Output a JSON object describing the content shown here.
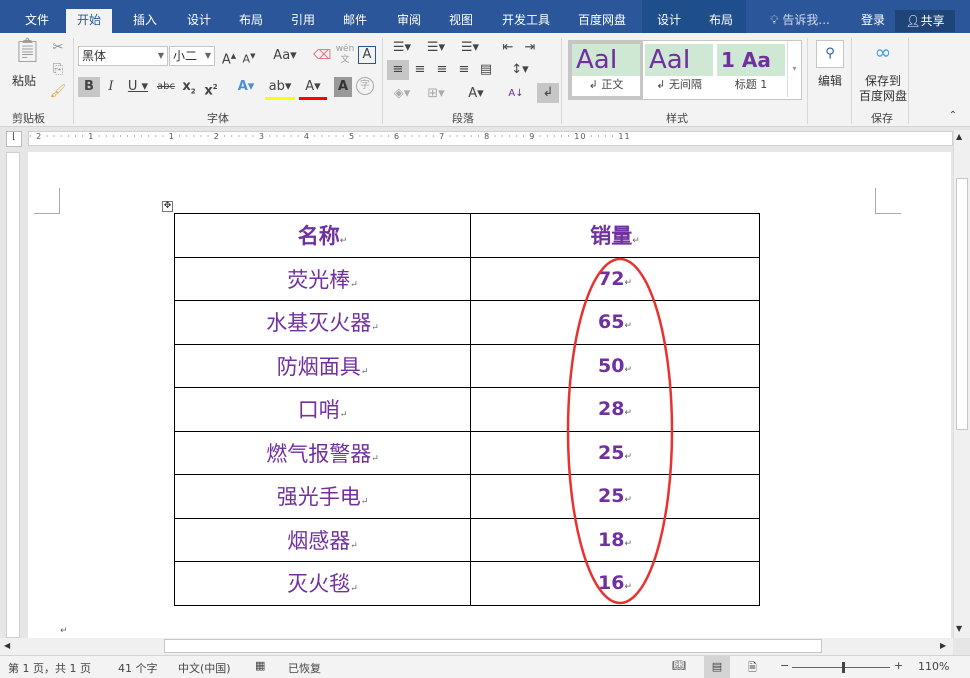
{
  "tabs": [
    "文件",
    "开始",
    "插入",
    "设计",
    "布局",
    "引用",
    "邮件",
    "审阅",
    "视图",
    "开发工具",
    "百度网盘",
    "设计",
    "布局"
  ],
  "active_tab": "开始",
  "tell_me": "告诉我...",
  "login": "登录",
  "share": "共享",
  "ribbon": {
    "clipboard": {
      "paste": "粘贴",
      "label": "剪贴板"
    },
    "font": {
      "family": "黑体",
      "size": "小二",
      "label": "字体"
    },
    "paragraph": {
      "label": "段落"
    },
    "styles": {
      "items": [
        {
          "preview": "AaI",
          "name": "正文"
        },
        {
          "preview": "AaI",
          "name": "无间隔"
        },
        {
          "preview": "1 Aa",
          "name": "标题 1"
        }
      ],
      "label": "样式"
    },
    "edit": {
      "label": "编辑"
    },
    "save": {
      "button": "保存到\n百度网盘",
      "label": "保存"
    }
  },
  "table": {
    "headers": [
      "名称",
      "销量"
    ],
    "rows": [
      [
        "荧光棒",
        "72"
      ],
      [
        "水基灭火器",
        "65"
      ],
      [
        "防烟面具",
        "50"
      ],
      [
        "口哨",
        "28"
      ],
      [
        "燃气报警器",
        "25"
      ],
      [
        "强光手电",
        "25"
      ],
      [
        "烟感器",
        "18"
      ],
      [
        "灭火毯",
        "16"
      ]
    ]
  },
  "annotation_color": "#e8322e",
  "text_color": "#7030a0",
  "status": {
    "page": "第 1 页，共 1 页",
    "words": "41 个字",
    "language": "中文(中国)",
    "recovered": "已恢复",
    "zoom": "110%"
  },
  "zoom_percent": 110
}
